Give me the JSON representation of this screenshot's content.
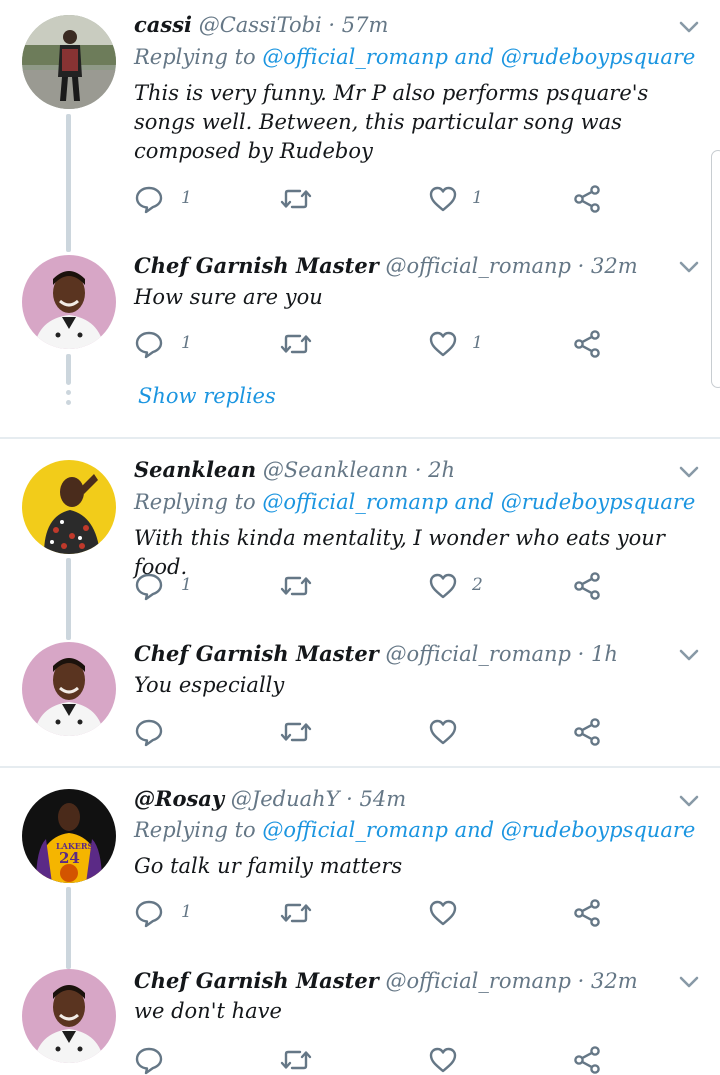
{
  "tweets": [
    {
      "name": "cassi",
      "handle": "@CassiTobi · 57m",
      "reply_prefix": "Replying to ",
      "reply_to": "@official_romanp and @rudeboypsquare",
      "text": "This is very funny. Mr P also performs psquare's songs well. Between, this particular song was composed by Rudeboy",
      "reply_count": "1",
      "like_count": "1"
    },
    {
      "name": "Chef Garnish Master",
      "handle": "@official_romanp · 32m",
      "text": "How sure are you",
      "reply_count": "1",
      "like_count": "1"
    },
    {
      "name": "Seanklean",
      "handle": "@Seankleann · 2h",
      "reply_prefix": "Replying to ",
      "reply_to": "@official_romanp and @rudeboypsquare",
      "text": "With this kinda mentality, I wonder who eats your food.",
      "reply_count": "1",
      "like_count": "2"
    },
    {
      "name": "Chef Garnish Master",
      "handle": "@official_romanp · 1h",
      "text": "You especially",
      "reply_count": "",
      "like_count": ""
    },
    {
      "name": "@Rosay",
      "handle": "@JeduahY · 54m",
      "reply_prefix": "Replying to ",
      "reply_to": "@official_romanp and @rudeboypsquare",
      "text": "Go talk ur family matters",
      "reply_count": "1",
      "like_count": ""
    },
    {
      "name": "Chef Garnish Master",
      "handle": "@official_romanp · 32m",
      "text": "we don't have"
    }
  ],
  "show_replies": "Show replies",
  "jersey_number": "24",
  "jersey_team": "LAKERS",
  "colors": {
    "link": "#1b95e0",
    "muted": "#657786",
    "thread": "#ccd6dd"
  },
  "icons": [
    "reply-icon",
    "retweet-icon",
    "like-icon",
    "share-icon",
    "chevron-down-icon"
  ]
}
